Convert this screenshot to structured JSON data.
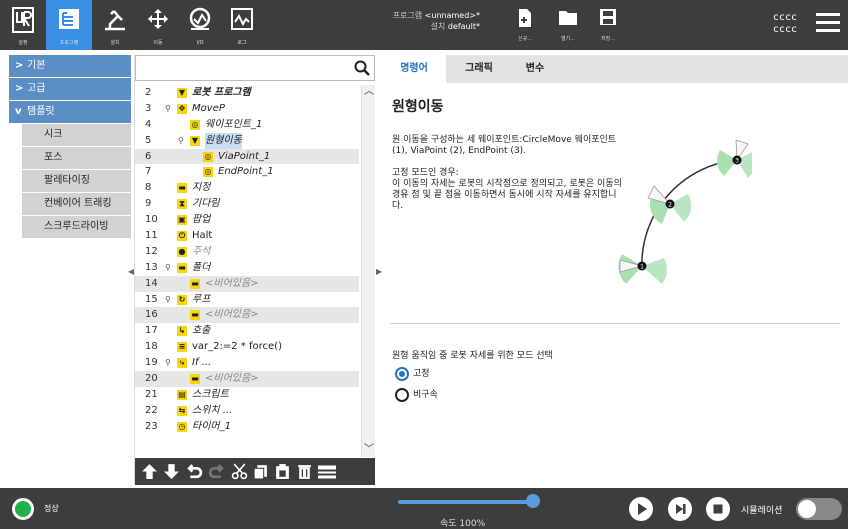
{
  "topbar": {
    "nav": [
      {
        "label": "설정",
        "icon": "ur-logo-icon"
      },
      {
        "label": "프로그램",
        "icon": "program-icon",
        "active": true
      },
      {
        "label": "설치",
        "icon": "install-icon"
      },
      {
        "label": "이동",
        "icon": "move-icon"
      },
      {
        "label": "I/O",
        "icon": "io-icon"
      },
      {
        "label": "로그",
        "icon": "log-icon"
      }
    ],
    "program_label": "프로그램",
    "program_value": "<unnamed>*",
    "install_label": "설치",
    "install_value": "default*",
    "file_buttons": [
      {
        "label": "신규...",
        "icon": "new-file-icon"
      },
      {
        "label": "열기...",
        "icon": "open-folder-icon"
      },
      {
        "label": "저장...",
        "icon": "save-icon"
      }
    ],
    "user_line1": "cccc",
    "user_line2": "cccc"
  },
  "leftnav": {
    "groups": [
      {
        "label": "기본",
        "chevron": ">"
      },
      {
        "label": "고급",
        "chevron": ">"
      },
      {
        "label": "템플릿",
        "chevron": "v"
      }
    ],
    "subitems": [
      "시크",
      "포스",
      "팔레타이징",
      "컨베이어 트래킹",
      "스크루드라이빙"
    ]
  },
  "tree": {
    "search_placeholder": "",
    "rows": [
      {
        "ln": "2",
        "icon": "▼",
        "text": "로봇 프로그램",
        "style": "it bold",
        "indent": 0,
        "pin": false,
        "alt": false
      },
      {
        "ln": "3",
        "icon": "✥",
        "text": "MoveP",
        "style": "it",
        "indent": 0,
        "pin": true,
        "alt": false
      },
      {
        "ln": "4",
        "icon": "◎",
        "text": "웨이포인트_1",
        "style": "it",
        "indent": 1,
        "pin": false,
        "alt": false
      },
      {
        "ln": "5",
        "icon": "▼",
        "text": "원형이동",
        "style": "it",
        "indent": 1,
        "pin": true,
        "alt": false,
        "selected": true
      },
      {
        "ln": "6",
        "icon": "◎",
        "text": "ViaPoint_1",
        "style": "it",
        "indent": 2,
        "pin": false,
        "alt": true
      },
      {
        "ln": "7",
        "icon": "◎",
        "text": "EndPoint_1",
        "style": "it",
        "indent": 2,
        "pin": false,
        "alt": false
      },
      {
        "ln": "8",
        "icon": "▬",
        "text": "지정",
        "style": "it",
        "indent": 0,
        "pin": false,
        "alt": false
      },
      {
        "ln": "9",
        "icon": "⧗",
        "text": "기다림",
        "style": "it",
        "indent": 0,
        "pin": false,
        "alt": false
      },
      {
        "ln": "10",
        "icon": "▣",
        "text": "팝업",
        "style": "it",
        "indent": 0,
        "pin": false,
        "alt": false
      },
      {
        "ln": "11",
        "icon": "⏻",
        "text": "Halt",
        "style": "",
        "indent": 0,
        "pin": false,
        "alt": false
      },
      {
        "ln": "12",
        "icon": "●",
        "text": "주석",
        "style": "gray",
        "indent": 0,
        "pin": false,
        "alt": false
      },
      {
        "ln": "13",
        "icon": "▬",
        "text": "폴더",
        "style": "it",
        "indent": 0,
        "pin": true,
        "alt": false
      },
      {
        "ln": "14",
        "icon": "▬",
        "text": "<비어있음>",
        "style": "gray",
        "indent": 1,
        "pin": false,
        "alt": true
      },
      {
        "ln": "15",
        "icon": "↻",
        "text": "루프",
        "style": "it",
        "indent": 0,
        "pin": true,
        "alt": false
      },
      {
        "ln": "16",
        "icon": "▬",
        "text": "<비어있음>",
        "style": "gray",
        "indent": 1,
        "pin": false,
        "alt": true
      },
      {
        "ln": "17",
        "icon": "↳",
        "text": "호출",
        "style": "it",
        "indent": 0,
        "pin": false,
        "alt": false
      },
      {
        "ln": "18",
        "icon": "≡",
        "text": "var_2:=2 * force()",
        "style": "",
        "indent": 0,
        "pin": false,
        "alt": false
      },
      {
        "ln": "19",
        "icon": "⤷",
        "text": "If ...",
        "style": "it",
        "indent": 0,
        "pin": true,
        "alt": false
      },
      {
        "ln": "20",
        "icon": "▬",
        "text": "<비어있음>",
        "style": "gray",
        "indent": 1,
        "pin": false,
        "alt": true
      },
      {
        "ln": "21",
        "icon": "▤",
        "text": "스크립트",
        "style": "it",
        "indent": 0,
        "pin": false,
        "alt": false
      },
      {
        "ln": "22",
        "icon": "⇆",
        "text": "스위치 ...",
        "style": "it",
        "indent": 0,
        "pin": false,
        "alt": false
      },
      {
        "ln": "23",
        "icon": "◷",
        "text": "타이머_1",
        "style": "it",
        "indent": 0,
        "pin": false,
        "alt": false
      }
    ]
  },
  "content": {
    "tabs": [
      "명령어",
      "그래픽",
      "변수"
    ],
    "heading": "원형이동",
    "desc1": "원 이동을 구성하는 세 웨이포인트:CircleMove 웨이포인트 (1), ViaPoint (2), EndPoint (3).",
    "desc2_title": "고정 모드인 경우:",
    "desc2": "이 이동의 자세는 로봇의 시작점으로 정의되고, 로봇은 이동의 경유 점 및 끝 점을 이동하면서 동시에 시작 자세를 유지합니다.",
    "point_labels": [
      "1",
      "2",
      "3"
    ],
    "mode_question": "원형 움직임 중 로봇 자세를 위한 모드 선택",
    "radio_fixed": "고정",
    "radio_unconstrained": "비구속",
    "selected_mode": "fixed"
  },
  "bottombar": {
    "status": "정상",
    "status_color": "#1fb04a",
    "speed_label": "속도 100%",
    "speed_percent": 100,
    "sim_label": "시뮬레이션",
    "accent": "#5a9be0"
  }
}
